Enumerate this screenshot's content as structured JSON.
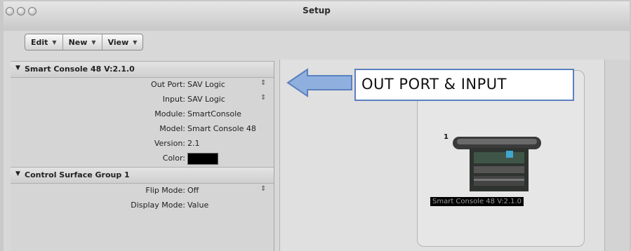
{
  "window": {
    "title": "Setup"
  },
  "toolbar": {
    "items": [
      {
        "label": "Edit"
      },
      {
        "label": "New"
      },
      {
        "label": "View"
      }
    ]
  },
  "inspector": {
    "section1": {
      "title": "Smart Console 48 V:2.1.0",
      "rows": [
        {
          "label": "Out Port:",
          "value": "SAV Logic"
        },
        {
          "label": "Input:",
          "value": "SAV Logic"
        },
        {
          "label": "Module:",
          "value": "SmartConsole"
        },
        {
          "label": "Model:",
          "value": "Smart Console 48"
        },
        {
          "label": "Version:",
          "value": "2.1"
        },
        {
          "label": "Color:",
          "value_color": "#000000"
        }
      ]
    },
    "section2": {
      "title": "Control Surface Group 1",
      "rows": [
        {
          "label": "Flip Mode:",
          "value": "Off"
        },
        {
          "label": "Display Mode:",
          "value": "Value"
        }
      ]
    }
  },
  "canvas": {
    "device": {
      "number": "1",
      "label": "Smart Console 48 V:2.1.0"
    }
  },
  "annotation": {
    "text": "OUT PORT & INPUT",
    "color": "#5b81be"
  }
}
